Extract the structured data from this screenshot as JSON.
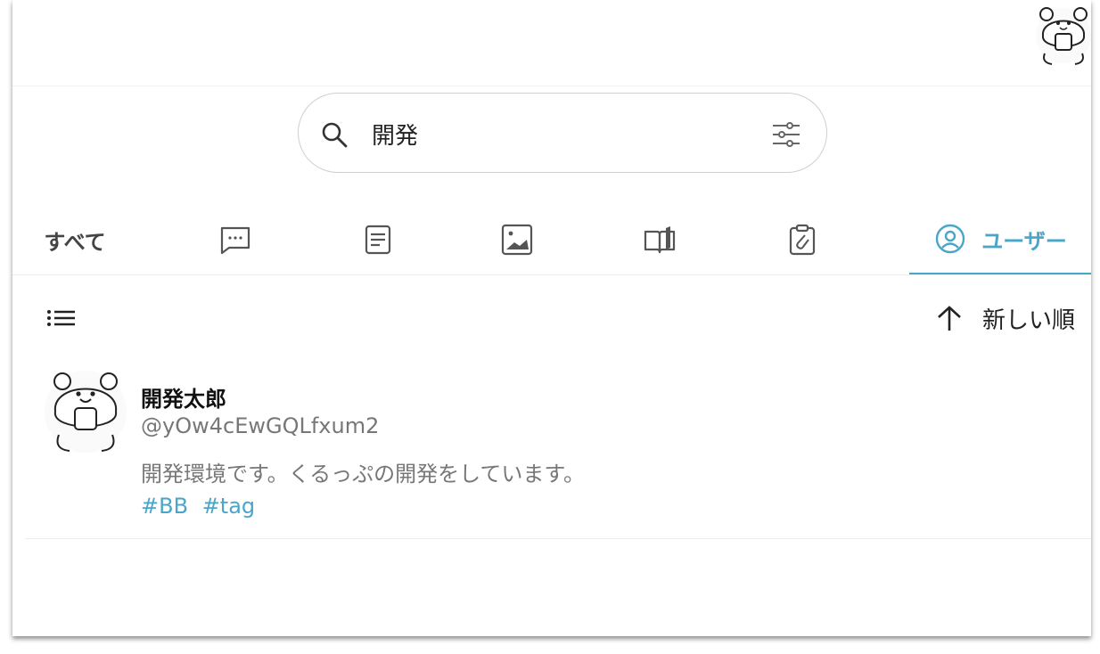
{
  "search": {
    "query": "開発",
    "placeholder": ""
  },
  "tabs": [
    {
      "label": "すべて",
      "icon": "all"
    },
    {
      "label": "",
      "icon": "comment-icon"
    },
    {
      "label": "",
      "icon": "article-icon"
    },
    {
      "label": "",
      "icon": "image-icon"
    },
    {
      "label": "",
      "icon": "book-icon"
    },
    {
      "label": "",
      "icon": "clip-icon"
    },
    {
      "label": "ユーザー",
      "icon": "user-circle-icon"
    }
  ],
  "active_tab": "ユーザー",
  "sort": {
    "label": "新しい順"
  },
  "user": {
    "name": "開発太郎",
    "handle": "@yOw4cEwGQLfxum2",
    "bio": "開発環境です。くるっぷの開発をしています。",
    "tags": [
      "#BB",
      "#tag"
    ]
  },
  "colors": {
    "accent": "#4aa6c9",
    "text": "#222222",
    "muted": "#777777"
  }
}
